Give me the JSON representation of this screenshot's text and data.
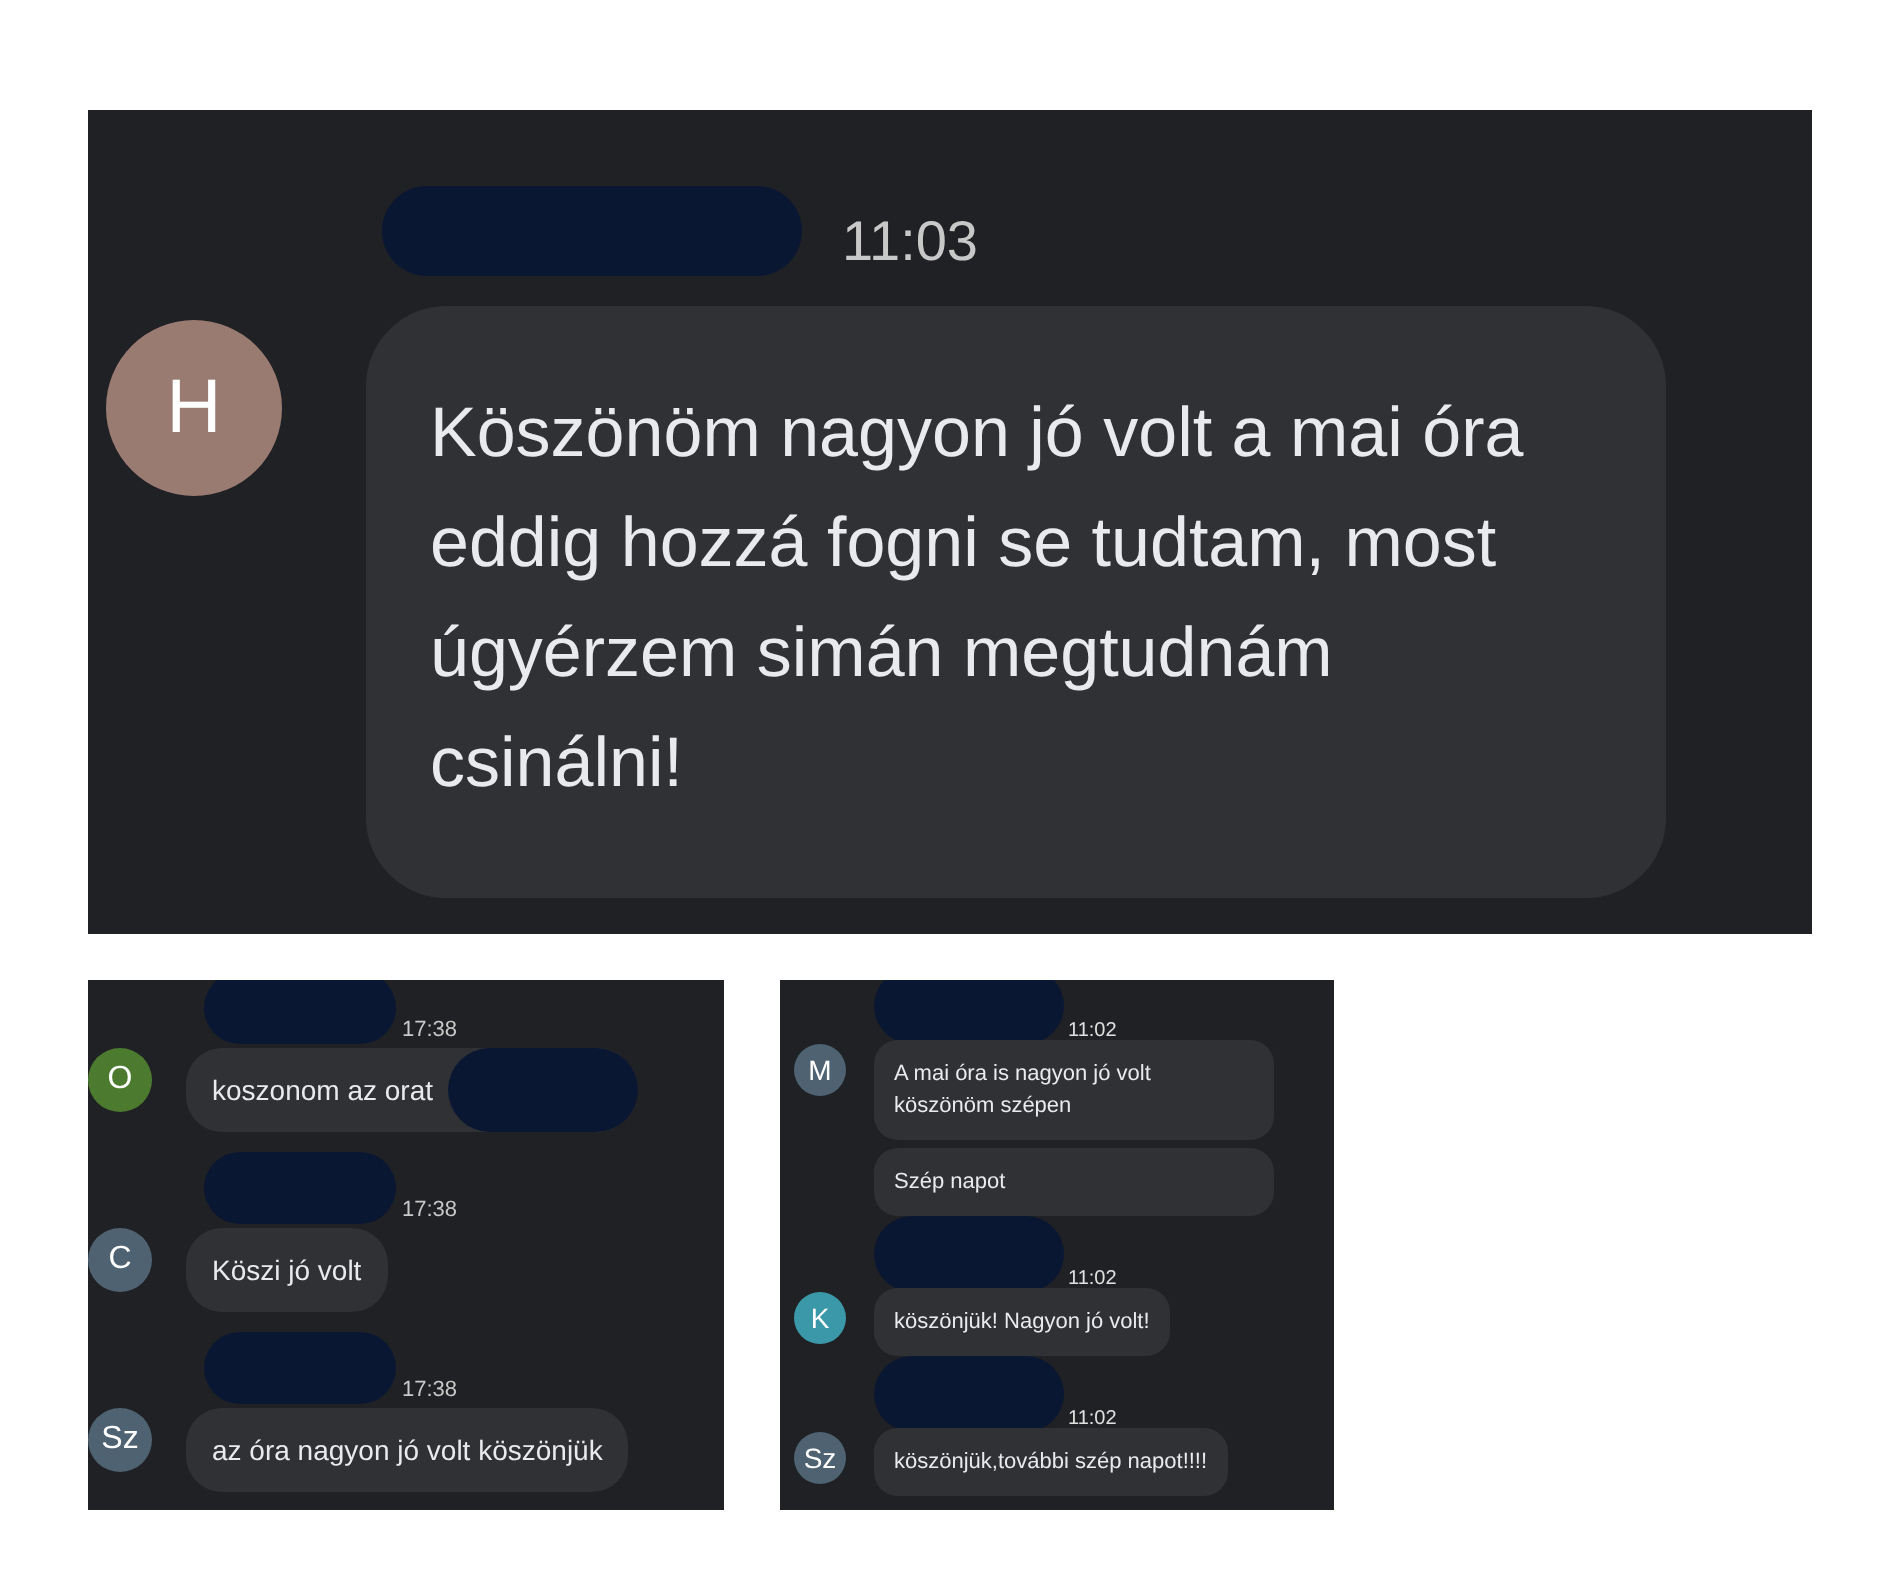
{
  "panels": [
    {
      "groups": [
        {
          "avatar": "H",
          "color": "#9a7b72",
          "name_redacted": true,
          "time": "11:03",
          "bubbles": [
            {
              "text": "Köszönöm nagyon jó volt a mai óra eddig hozzá fogni se tudtam, most úgyérzem simán megtudnám csinálni!",
              "text_redacted": false
            }
          ]
        }
      ]
    },
    {
      "groups": [
        {
          "avatar": "O",
          "color": "#4c7a2f",
          "name_redacted": true,
          "time": "17:38",
          "bubbles": [
            {
              "text": "koszonom az orat",
              "text_redacted": true
            }
          ]
        },
        {
          "avatar": "C",
          "color": "#4e6272",
          "name_redacted": true,
          "time": "17:38",
          "bubbles": [
            {
              "text": "Köszi jó volt",
              "text_redacted": false
            }
          ]
        },
        {
          "avatar": "Sz",
          "color": "#4e6272",
          "name_redacted": true,
          "time": "17:38",
          "bubbles": [
            {
              "text": "az óra nagyon jó volt köszönjük",
              "text_redacted": false
            }
          ]
        }
      ]
    },
    {
      "groups": [
        {
          "avatar": "M",
          "color": "#4e6272",
          "name_redacted": true,
          "time": "11:02",
          "bubbles": [
            {
              "text": "A mai óra is nagyon jó volt köszönöm szépen",
              "text_redacted": false
            },
            {
              "text": "Szép napot",
              "text_redacted": false
            }
          ]
        },
        {
          "avatar": "K",
          "color": "#3a98a8",
          "name_redacted": true,
          "time": "11:02",
          "bubbles": [
            {
              "text": "köszönjük! Nagyon jó volt!",
              "text_redacted": false
            }
          ]
        },
        {
          "avatar": "Sz",
          "color": "#4e6272",
          "name_redacted": true,
          "time": "11:02",
          "bubbles": [
            {
              "text": "köszönjük,további szép napot!!!!",
              "text_redacted": false
            }
          ]
        }
      ]
    }
  ]
}
